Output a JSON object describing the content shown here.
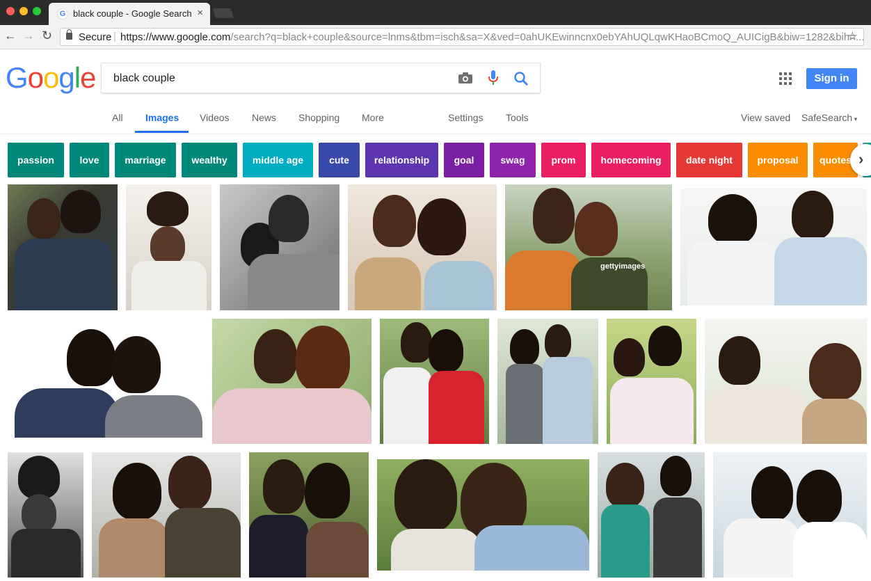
{
  "browser": {
    "tab_title": "black couple - Google Search",
    "favicon_letter": "G",
    "secure_label": "Secure",
    "url_host": "https://www.google.com",
    "url_path": "/search?q=black+couple&source=lnms&tbm=isch&sa=X&ved=0ahUKEwinncnx0ebYAhUQLqwKHaoBCmoQ_AUICigB&biw=1282&bih=..."
  },
  "header": {
    "logo_letters": [
      "G",
      "o",
      "o",
      "g",
      "l",
      "e"
    ],
    "logo_colors": [
      "#4285f4",
      "#ea4335",
      "#fbbc05",
      "#4285f4",
      "#34a853",
      "#ea4335"
    ],
    "search_value": "black couple",
    "sign_in_label": "Sign in"
  },
  "tabs": {
    "all": "All",
    "images": "Images",
    "videos": "Videos",
    "news": "News",
    "shopping": "Shopping",
    "more": "More",
    "settings": "Settings",
    "tools": "Tools",
    "view_saved": "View saved",
    "safesearch": "SafeSearch"
  },
  "chips": [
    {
      "label": "passion",
      "color": "#00897b"
    },
    {
      "label": "love",
      "color": "#00897b"
    },
    {
      "label": "marriage",
      "color": "#00897b"
    },
    {
      "label": "wealthy",
      "color": "#00897b"
    },
    {
      "label": "middle age",
      "color": "#00acc1"
    },
    {
      "label": "cute",
      "color": "#3949ab"
    },
    {
      "label": "relationship",
      "color": "#5e35b1"
    },
    {
      "label": "goal",
      "color": "#7b1fa2"
    },
    {
      "label": "swag",
      "color": "#8e24aa"
    },
    {
      "label": "prom",
      "color": "#e91e63"
    },
    {
      "label": "homecoming",
      "color": "#e91e63"
    },
    {
      "label": "date night",
      "color": "#e53935"
    },
    {
      "label": "proposal",
      "color": "#fb8c00"
    },
    {
      "label": "quotes",
      "color": "#fb8c00"
    }
  ],
  "images": {
    "watermark": "gettyimages"
  }
}
